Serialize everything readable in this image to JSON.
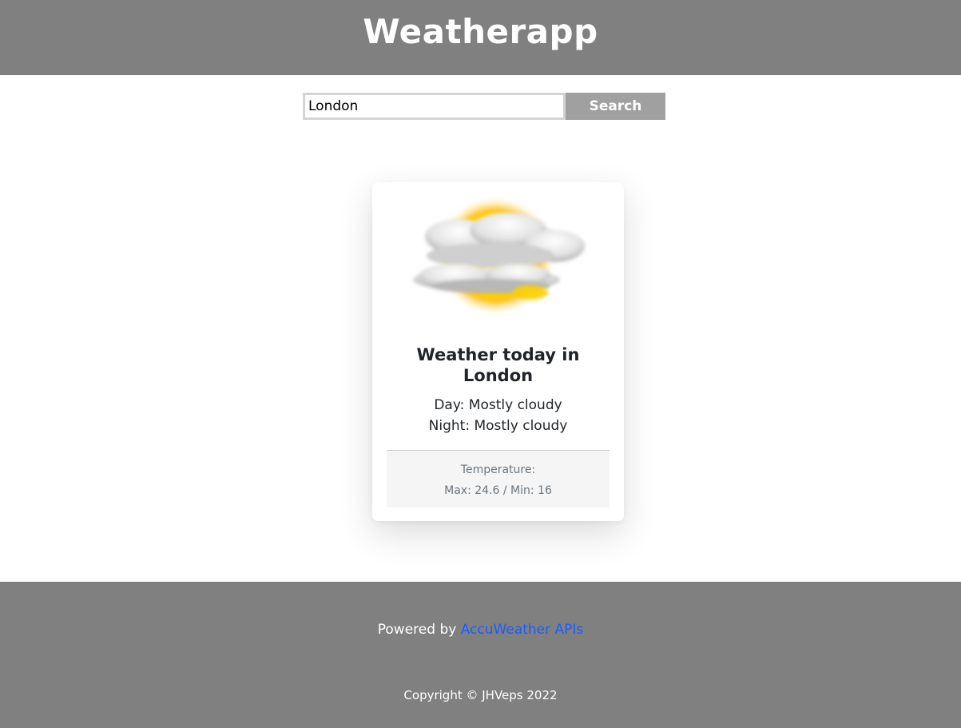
{
  "header": {
    "title": "Weatherapp"
  },
  "search": {
    "value": "London",
    "button_label": "Search"
  },
  "card": {
    "icon": "mostly-cloudy-icon",
    "title_line1": "Weather today in",
    "title_line2": "London",
    "day_text": "Day: Mostly cloudy",
    "night_text": "Night: Mostly cloudy",
    "temperature_label": "Temperature:",
    "temperature_values": "Max: 24.6 / Min: 16"
  },
  "footer": {
    "powered_prefix": "Powered by ",
    "powered_link": "AccuWeather APIs",
    "copyright": "Copyright © JHVeps 2022"
  },
  "colors": {
    "header_bg": "#808080",
    "button_bg": "#a0a0a0",
    "link": "#1a5cff",
    "card_footer_bg": "#f5f5f5"
  }
}
